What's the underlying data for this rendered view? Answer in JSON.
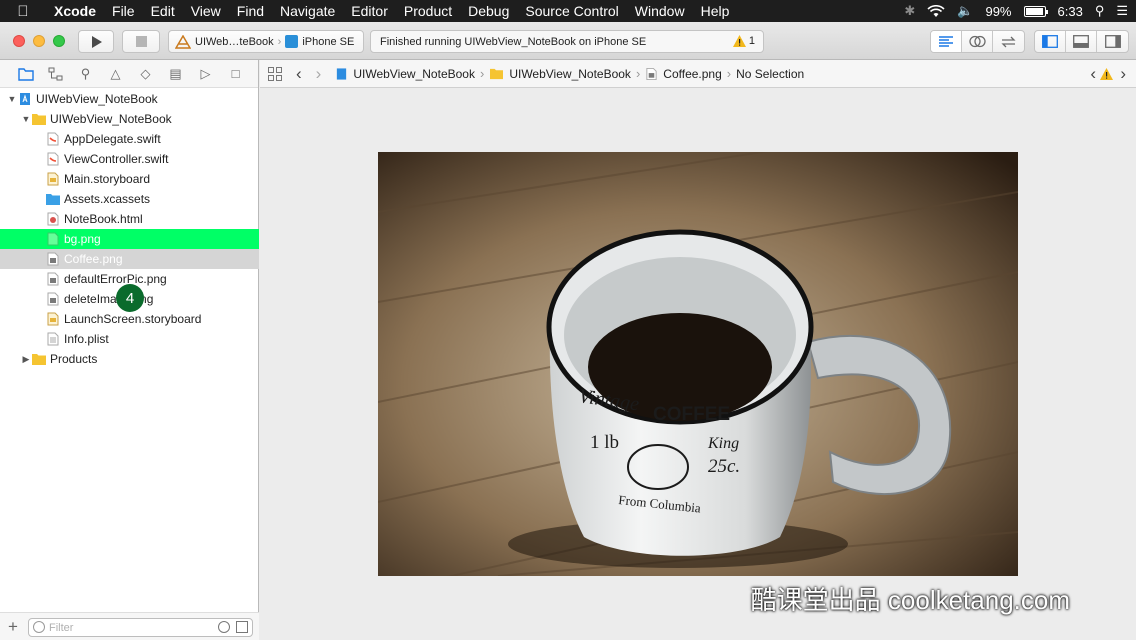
{
  "menubar": {
    "app": "Xcode",
    "items": [
      "File",
      "Edit",
      "View",
      "Find",
      "Navigate",
      "Editor",
      "Product",
      "Debug",
      "Source Control",
      "Window",
      "Help"
    ],
    "battery": "99%",
    "time": "6:33"
  },
  "toolbar": {
    "scheme_name": "UIWeb…teBook",
    "device": "iPhone SE",
    "status_text": "Finished running UIWebView_NoteBook on iPhone SE",
    "warning_count": "1"
  },
  "navigator": {
    "project": "UIWebView_NoteBook",
    "group": "UIWebView_NoteBook",
    "files": [
      "AppDelegate.swift",
      "ViewController.swift",
      "Main.storyboard",
      "Assets.xcassets",
      "NoteBook.html",
      "bg.png",
      "Coffee.png",
      "defaultErrorPic.png",
      "deleteImage.png",
      "LaunchScreen.storyboard",
      "Info.plist"
    ],
    "products": "Products",
    "step_badge": "4",
    "filter_placeholder": "Filter"
  },
  "jumpbar": {
    "project": "UIWebView_NoteBook",
    "group": "UIWebView_NoteBook",
    "file": "Coffee.png",
    "selection": "No Selection"
  },
  "image": {
    "mug_text_1": "Vintage",
    "mug_text_2": "COFFEE",
    "mug_text_3": "1 lb",
    "mug_text_4": "King",
    "mug_text_5": "25c.",
    "mug_text_6": "From Columbia"
  },
  "watermark": "酷课堂出品 coolketang.com"
}
